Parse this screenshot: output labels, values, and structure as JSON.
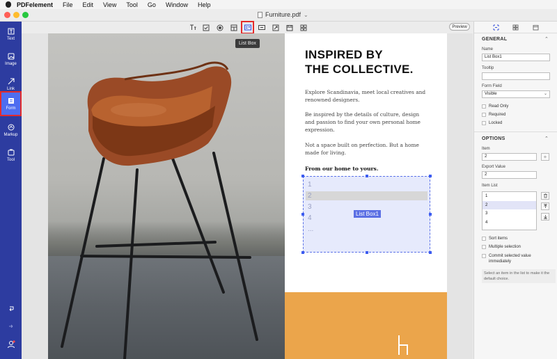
{
  "menubar": {
    "app": "PDFelement",
    "items": [
      "File",
      "Edit",
      "View",
      "Tool",
      "Go",
      "Window",
      "Help"
    ]
  },
  "window": {
    "title": "Furniture.pdf"
  },
  "sidebar": {
    "items": [
      {
        "label": "Text",
        "icon": "text-icon"
      },
      {
        "label": "Image",
        "icon": "image-icon"
      },
      {
        "label": "Link",
        "icon": "link-icon"
      },
      {
        "label": "Form",
        "icon": "form-icon",
        "active": true
      },
      {
        "label": "Markup",
        "icon": "markup-icon"
      },
      {
        "label": "Tool",
        "icon": "tool-icon"
      }
    ]
  },
  "toolbar": {
    "tools": [
      "text-field-icon",
      "checkbox-icon",
      "radio-button-icon",
      "combo-box-icon",
      "list-box-icon",
      "button-icon",
      "image-field-icon",
      "date-field-icon",
      "grid-icon"
    ],
    "selected_tool": "list-box-icon",
    "preview_label": "Preview",
    "tooltip": "List Box"
  },
  "document": {
    "heading_line1": "INSPIRED BY",
    "heading_line2": "THE COLLECTIVE.",
    "para1": "Explore Scandinavia, meet local creatives and renowned designers.",
    "para2": "Be inspired by the details of culture, design and passion to find your own personal home expression.",
    "para3": "Not a space built on perfection. But a home made for living.",
    "bold_line": "From our home to yours.",
    "listbox": {
      "rows": [
        "1",
        "2",
        "3",
        "4",
        "..."
      ],
      "highlighted_index": 1,
      "label": "List Box1"
    }
  },
  "panel": {
    "general_title": "GENERAL",
    "name_label": "Name",
    "name_value": "List Box1",
    "tooltip_label": "Tooltip",
    "tooltip_value": "",
    "form_field_label": "Form Field",
    "form_field_value": "Visible",
    "checks": [
      "Read Only",
      "Required",
      "Locked"
    ],
    "options_title": "OPTIONS",
    "item_label": "Item",
    "item_value": "2",
    "export_label": "Export Value",
    "export_value": "2",
    "item_list_label": "Item List",
    "item_list": [
      "1",
      "2",
      "3",
      "4"
    ],
    "item_list_selected": 1,
    "options_checks": [
      "Sort items",
      "Multiple selection",
      "Commit selected value immediately"
    ],
    "note": "Select an item in the list to make it the default choice."
  },
  "colors": {
    "sidebar": "#2d3ca0",
    "active": "#4e6df0",
    "highlight_red": "#e42b2b",
    "orange_block": "#eba54b"
  }
}
